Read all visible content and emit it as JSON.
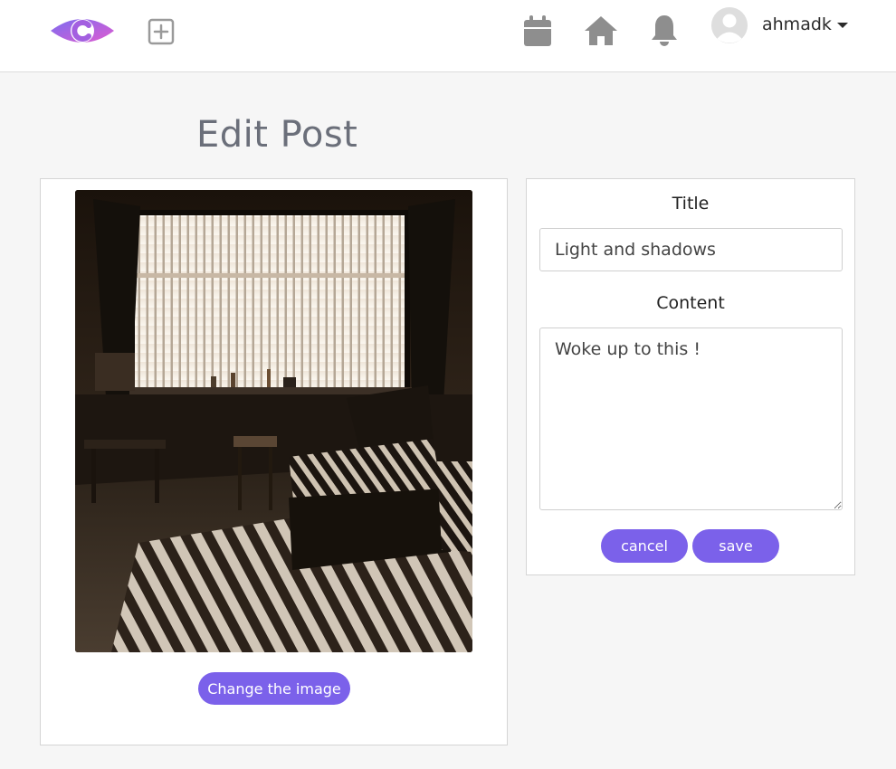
{
  "navbar": {
    "logo_name": "c-eye-logo",
    "icons": [
      "plus-square-icon",
      "calendar-icon",
      "home-icon",
      "bell-icon"
    ],
    "username": "ahmadk"
  },
  "page": {
    "title": "Edit Post"
  },
  "image_card": {
    "change_button_label": "Change the image"
  },
  "form": {
    "title_label": "Title",
    "title_value": "Light and shadows",
    "content_label": "Content",
    "content_value": "Woke up to this !",
    "cancel_label": "cancel",
    "save_label": "save"
  },
  "colors": {
    "accent": "#7b61ea",
    "icon_gray": "#8e8e8e",
    "logo_gradient": [
      "#7c6cf0",
      "#e05bd0"
    ]
  }
}
